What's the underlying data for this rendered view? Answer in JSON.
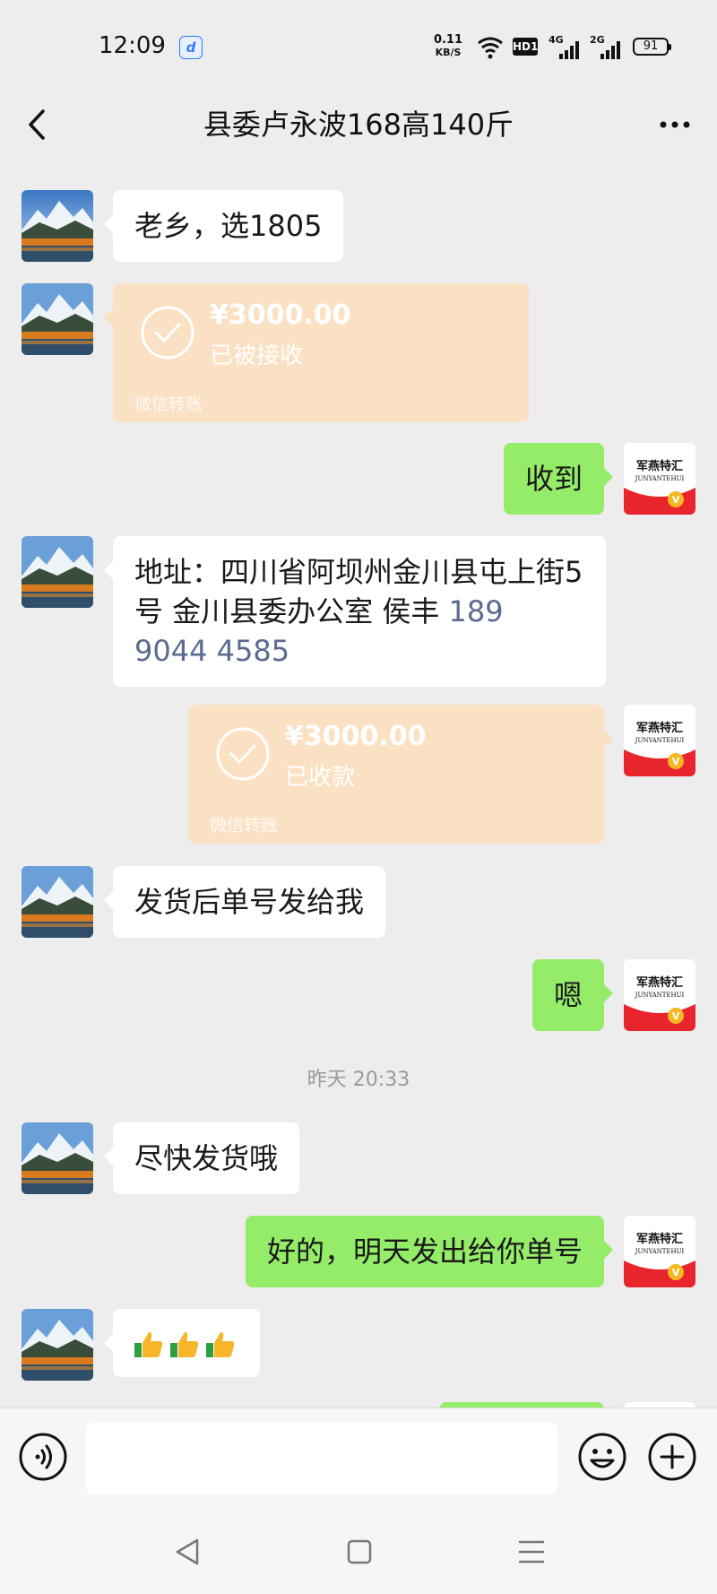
{
  "status_bar": {
    "time": "12:09",
    "net_speed_value": "0.11",
    "net_speed_unit": "KB/S",
    "hd_label": "HD1",
    "net1": "4G",
    "net2": "2G",
    "battery": "91"
  },
  "header": {
    "title": "县委卢永波168高140斤"
  },
  "messages": {
    "m1": "老乡，选1805",
    "t1": {
      "amount": "¥3000.00",
      "status": "已被接收",
      "source": "微信转账"
    },
    "m2": "收到",
    "m3_text": "地址：四川省阿坝州金川县屯上街5号  金川县委办公室  侯丰  ",
    "m3_phone": "189 9044 4585",
    "t2": {
      "amount": "¥3000.00",
      "status": "已收款",
      "source": "微信转账"
    },
    "m4": "发货后单号发给我",
    "m5": "嗯",
    "time_divider": "昨天 20:33",
    "m6": "尽快发货哦",
    "m7": "好的，明天发出给你单号"
  },
  "contact_avatar": {
    "icon": "mountain-lake-photo"
  },
  "self_avatar": {
    "brand_cn": "军燕特汇",
    "brand_en": "JUNYANTEHUI",
    "badge": "V"
  },
  "input": {
    "placeholder": ""
  },
  "colors": {
    "bubble_green": "#95ec69",
    "transfer": "#fbe1c3",
    "background": "#ededed"
  }
}
